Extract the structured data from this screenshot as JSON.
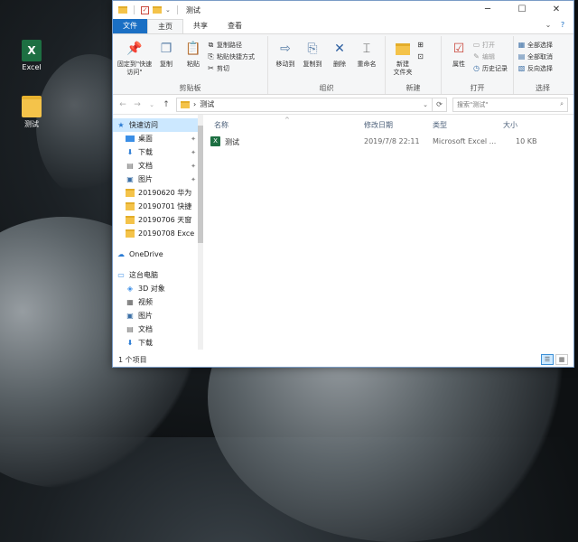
{
  "desktop": {
    "icons": [
      {
        "label": "Excel",
        "glyph": "X"
      },
      {
        "label": "测试"
      }
    ]
  },
  "window": {
    "title": "测试",
    "controls": {
      "minimize": "─",
      "maximize": "☐",
      "close": "✕"
    }
  },
  "tabs": {
    "file": "文件",
    "home": "主页",
    "share": "共享",
    "view": "查看",
    "collapse": "⌄",
    "help": "?"
  },
  "ribbon": {
    "clipboard": {
      "label": "剪贴板",
      "pin": "固定到\"快速访问\"",
      "copy": "复制",
      "paste": "粘贴",
      "copy_path": "复制路径",
      "paste_shortcut": "粘贴快捷方式",
      "cut": "剪切"
    },
    "organize": {
      "label": "组织",
      "move_to": "移动到",
      "copy_to": "复制到",
      "delete": "删除",
      "rename": "重命名"
    },
    "new": {
      "label": "新建",
      "new_folder": "新建\n文件夹"
    },
    "open": {
      "label": "打开",
      "properties": "属性",
      "open": "打开",
      "edit": "编辑",
      "history": "历史记录"
    },
    "select": {
      "label": "选择",
      "select_all": "全部选择",
      "select_none": "全部取消",
      "invert": "反向选择"
    }
  },
  "address": {
    "back": "←",
    "forward": "→",
    "recent": "⌄",
    "up": "↑",
    "separator": "›",
    "path": "测试",
    "dropdown": "⌄",
    "refresh": "⟳",
    "search_placeholder": "搜索\"测试\"",
    "search_icon": "⌕"
  },
  "nav": {
    "quick_access": "快速访问",
    "items": [
      {
        "label": "桌面",
        "icon": "desktop-icon",
        "pinned": true
      },
      {
        "label": "下载",
        "icon": "download-icon",
        "pinned": true
      },
      {
        "label": "文档",
        "icon": "documents-icon",
        "pinned": true
      },
      {
        "label": "图片",
        "icon": "pictures-icon",
        "pinned": true
      },
      {
        "label": "20190620 华为",
        "icon": "folder-icon"
      },
      {
        "label": "20190701 快捷",
        "icon": "folder-icon"
      },
      {
        "label": "20190706 天窗",
        "icon": "folder-icon"
      },
      {
        "label": "20190708 Exce",
        "icon": "folder-icon"
      }
    ],
    "onedrive": "OneDrive",
    "this_pc": "这台电脑",
    "pc_items": [
      {
        "label": "3D 对象",
        "icon": "3d-objects-icon"
      },
      {
        "label": "视频",
        "icon": "videos-icon"
      },
      {
        "label": "图片",
        "icon": "pictures-icon"
      },
      {
        "label": "文档",
        "icon": "documents-icon"
      },
      {
        "label": "下载",
        "icon": "download-icon"
      }
    ]
  },
  "columns": {
    "name": "名称",
    "date": "修改日期",
    "type": "类型",
    "size": "大小",
    "sort_arrow": "^"
  },
  "files": [
    {
      "name": "测试",
      "date": "2019/7/8 22:11",
      "type": "Microsoft Excel ...",
      "size": "10 KB",
      "icon_glyph": "X"
    }
  ],
  "status": {
    "count": "1 个项目"
  }
}
